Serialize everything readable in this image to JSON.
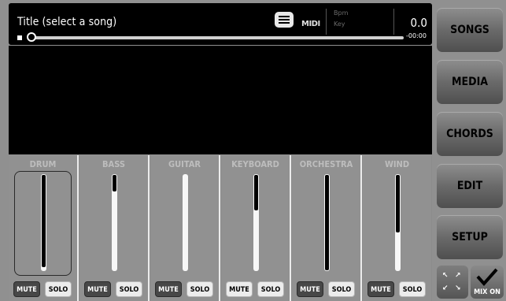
{
  "player": {
    "title": "Title (select a song)",
    "bpm_label": "Bpm",
    "key_label": "Key",
    "bpm_value": "0.0",
    "time_remaining": "-00:00",
    "midi_label": "MIDI",
    "progress": 0.0
  },
  "channels": [
    {
      "name": "DRUM",
      "mute": "MUTE",
      "solo": "SOLO",
      "mute_on": true,
      "level": 0.97,
      "selected": true
    },
    {
      "name": "BASS",
      "mute": "MUTE",
      "solo": "SOLO",
      "mute_on": true,
      "level": 0.17,
      "selected": false
    },
    {
      "name": "GUITAR",
      "mute": "MUTE",
      "solo": "SOLO",
      "mute_on": true,
      "level": 0.0,
      "selected": false
    },
    {
      "name": "KEYBOARD",
      "mute": "MUTE",
      "solo": "SOLO",
      "mute_on": false,
      "level": 0.37,
      "selected": false
    },
    {
      "name": "ORCHESTRA",
      "mute": "MUTE",
      "solo": "SOLO",
      "mute_on": true,
      "level": 1.0,
      "selected": false
    },
    {
      "name": "WIND",
      "mute": "MUTE",
      "solo": "SOLO",
      "mute_on": true,
      "level": 0.6,
      "selected": false
    }
  ],
  "sidebar": {
    "songs": "SONGS",
    "media": "MEDIA",
    "chords": "CHORDS",
    "edit": "EDIT",
    "setup": "SETUP",
    "mix_on": "MIX ON"
  }
}
